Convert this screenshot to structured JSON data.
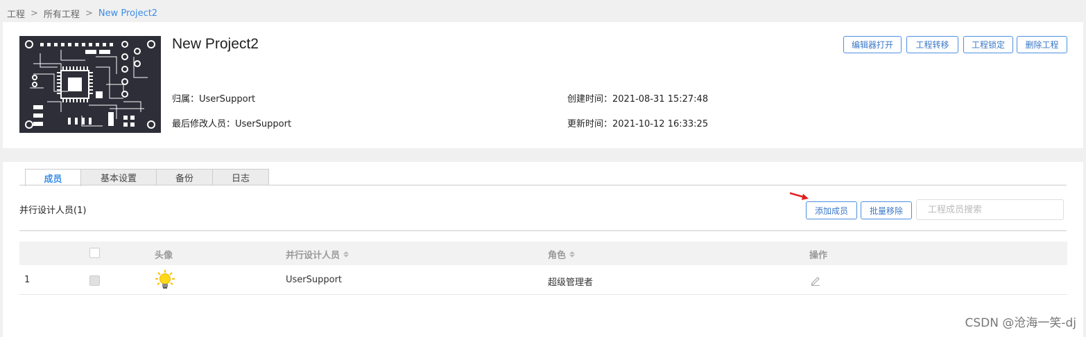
{
  "breadcrumb": {
    "items": [
      "工程",
      "所有工程",
      "New Project2"
    ],
    "separator": ">"
  },
  "project": {
    "name": "New Project2",
    "owner_label": "归属：",
    "owner_value": "UserSupport",
    "modifier_label": "最后修改人员：",
    "modifier_value": "UserSupport",
    "created_label": "创建时间：",
    "created_value": "2021-08-31 15:27:48",
    "updated_label": "更新时间：",
    "updated_value": "2021-10-12 16:33:25",
    "thumbnail_icon": "pcb-board-thumbnail"
  },
  "actions": {
    "open_editor": "编辑器打开",
    "transfer": "工程转移",
    "lock": "工程锁定",
    "delete": "删除工程"
  },
  "tabs": [
    "成员",
    "基本设置",
    "备份",
    "日志"
  ],
  "active_tab": "成员",
  "members": {
    "section_title": "并行设计人员(1)",
    "add_button": "添加成员",
    "batch_remove_button": "批量移除",
    "search_placeholder": "工程成员搜索",
    "columns": {
      "avatar": "头像",
      "designer": "并行设计人员",
      "role": "角色",
      "action": "操作"
    },
    "rows": [
      {
        "index": "1",
        "avatar_icon": "lightbulb-icon",
        "name": "UserSupport",
        "role": "超级管理者",
        "action_icon": "edit-pencil-icon"
      }
    ]
  },
  "watermark": "CSDN @沧海一笑-dj",
  "colors": {
    "accent": "#3b8ee8",
    "button_border": "#4b8fe0",
    "annotation_arrow": "#e02020"
  }
}
